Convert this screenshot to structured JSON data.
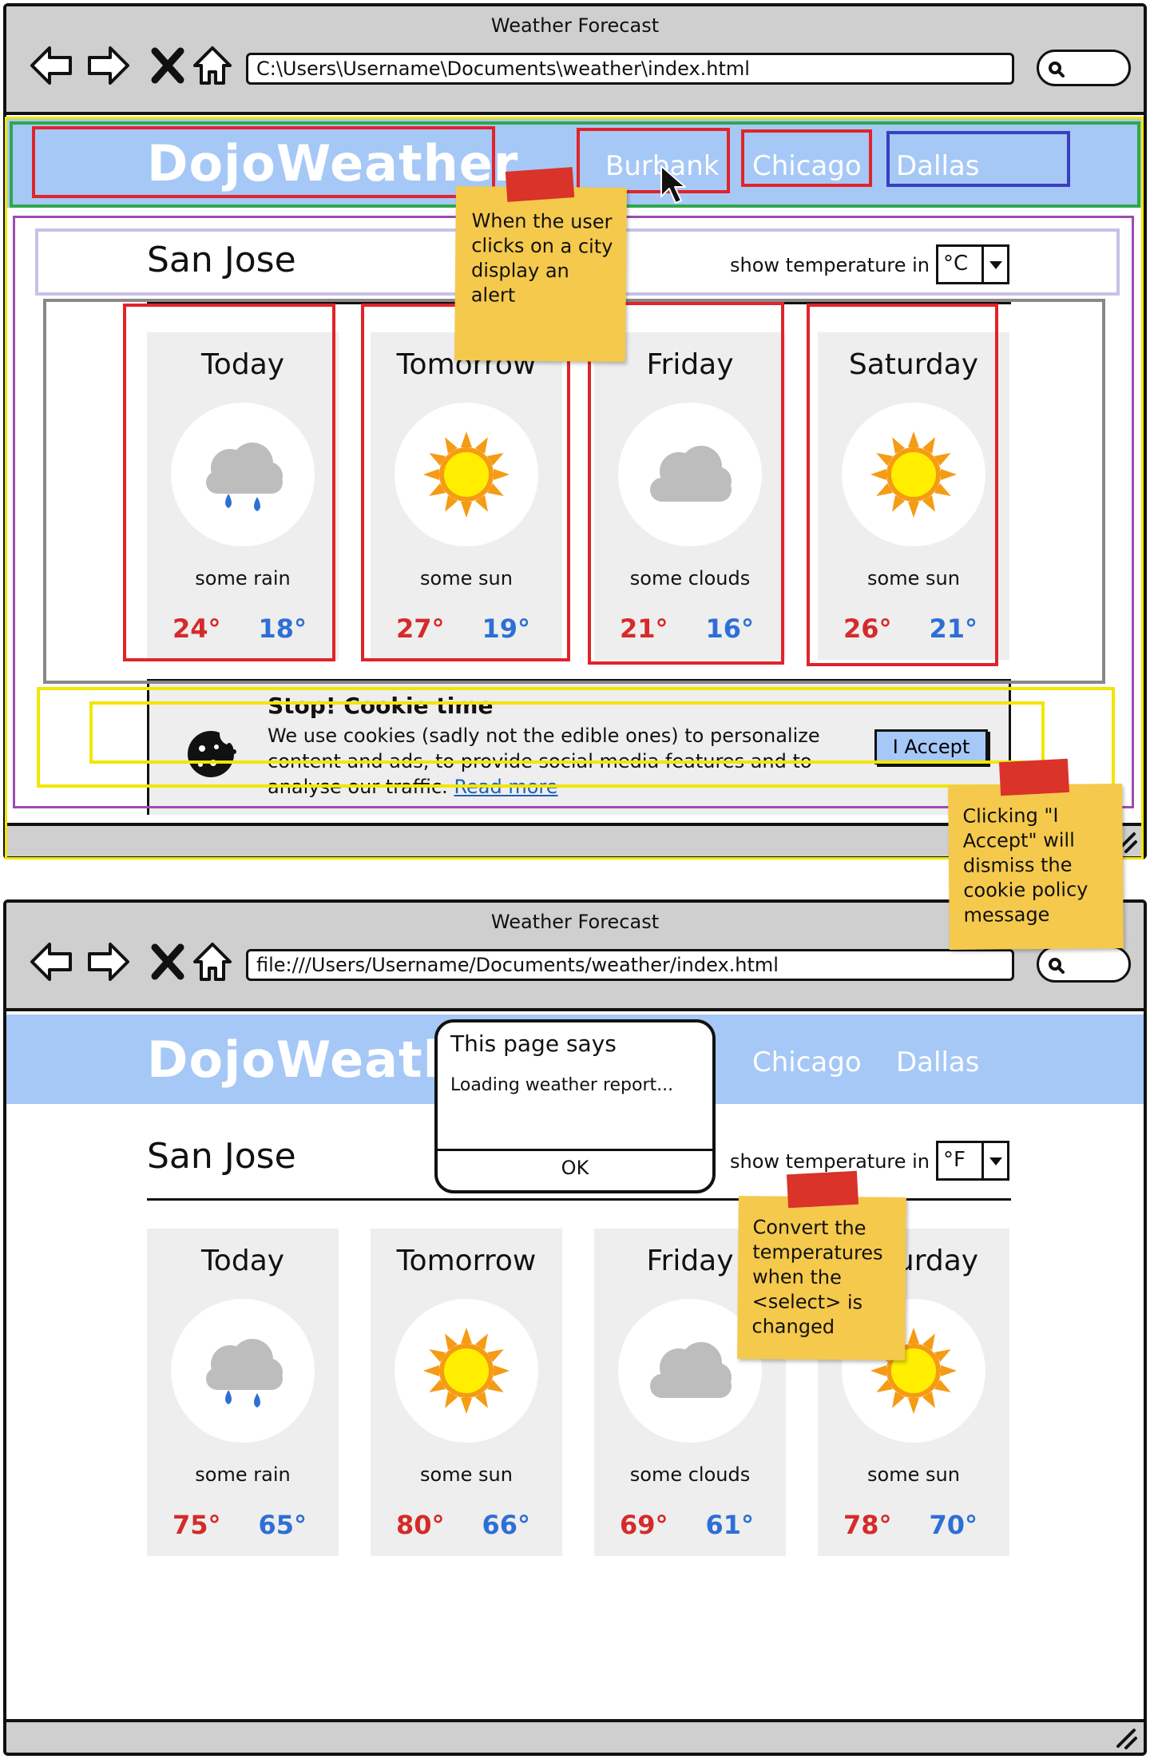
{
  "window_title": "Weather Forecast",
  "screen1": {
    "url": "C:\\Users\\Username\\Documents\\weather\\index.html",
    "logo": "DojoWeather",
    "nav": [
      "Burbank",
      "Chicago",
      "Dallas"
    ],
    "city": "San Jose",
    "temp_label": "show temperature in",
    "unit": "°C",
    "forecast": [
      {
        "day": "Today",
        "desc": "some rain",
        "hi": "24°",
        "lo": "18°",
        "icon": "rain-icon"
      },
      {
        "day": "Tomorrow",
        "desc": "some sun",
        "hi": "27°",
        "lo": "19°",
        "icon": "sun-icon"
      },
      {
        "day": "Friday",
        "desc": "some clouds",
        "hi": "21°",
        "lo": "16°",
        "icon": "cloud-icon"
      },
      {
        "day": "Saturday",
        "desc": "some sun",
        "hi": "26°",
        "lo": "21°",
        "icon": "sun-icon"
      }
    ],
    "cookie": {
      "title": "Stop! Cookie time",
      "text": "We use cookies (sadly not the edible ones) to personalize content and ads, to provide social media features and to analyse our traffic.",
      "link": "Read more",
      "button": "I Accept"
    }
  },
  "screen2": {
    "url": "file:///Users/Username/Documents/weather/index.html",
    "logo": "DojoWeather",
    "nav": [
      "Chicago",
      "Dallas"
    ],
    "city": "San Jose",
    "temp_label": "show temperature in",
    "unit": "°F",
    "forecast": [
      {
        "day": "Today",
        "desc": "some rain",
        "hi": "75°",
        "lo": "65°",
        "icon": "rain-icon"
      },
      {
        "day": "Tomorrow",
        "desc": "some sun",
        "hi": "80°",
        "lo": "66°",
        "icon": "sun-icon"
      },
      {
        "day": "Friday",
        "desc": "some clouds",
        "hi": "69°",
        "lo": "61°",
        "icon": "cloud-icon"
      },
      {
        "day": "Saturday",
        "desc": "some sun",
        "hi": "78°",
        "lo": "70°",
        "icon": "sun-icon"
      }
    ],
    "alert": {
      "title": "This page says",
      "message": "Loading weather report...",
      "ok": "OK"
    }
  },
  "notes": {
    "city_click": "When the user clicks on a city display an alert",
    "accept": "Clicking \"I Accept\" will dismiss the cookie policy message",
    "convert": "Convert the temperatures when the <select> is changed"
  },
  "colors": {
    "header": "#a6c8f6",
    "card": "#eeeeee",
    "hi_temp": "#d62a2a",
    "lo_temp": "#2e6fd6",
    "sticky": "#f5c94c",
    "tape": "#d9332a"
  }
}
